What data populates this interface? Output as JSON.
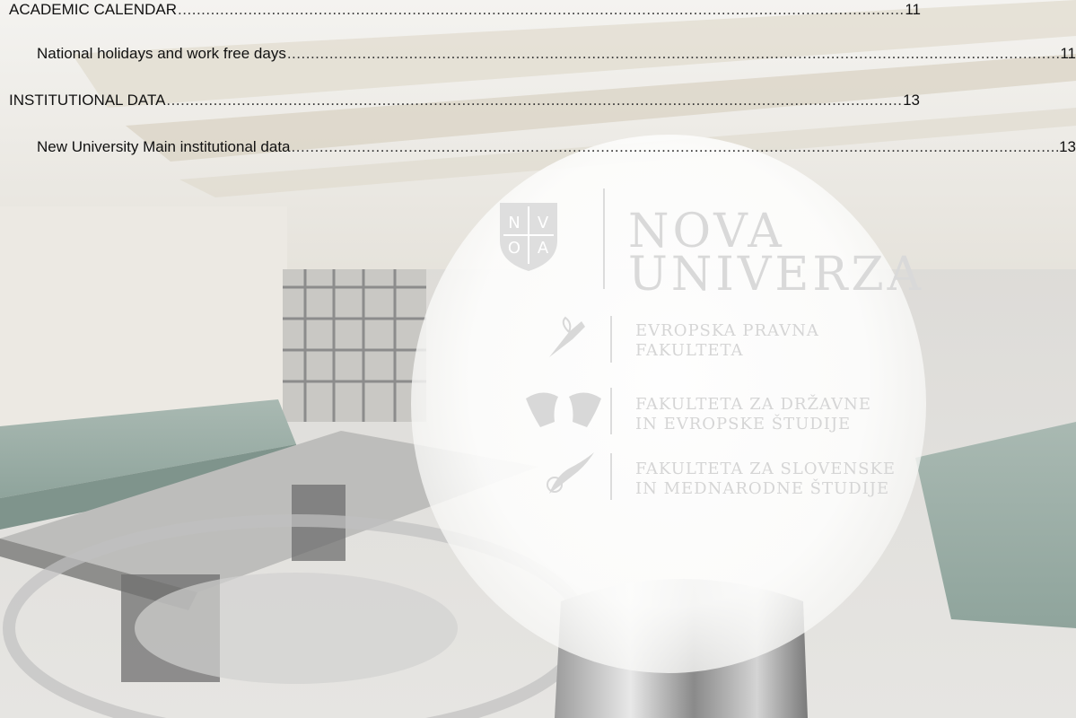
{
  "toc": [
    {
      "level": 1,
      "title": "ACADEMIC CALENDAR",
      "page": "11"
    },
    {
      "level": 2,
      "title": "National holidays and work free days",
      "page": "11"
    },
    {
      "level": 1,
      "title": "INSTITUTIONAL DATA",
      "page": "13"
    },
    {
      "level": 2,
      "title": "New University Main institutional data",
      "page": "13"
    }
  ],
  "logo": {
    "shield_letters": [
      "N",
      "V",
      "O",
      "A"
    ],
    "line1": "NOVA",
    "line2": "UNIVERZA"
  },
  "faculties": [
    {
      "line1": "EVROPSKA PRAVNA",
      "line2": "FAKULTETA",
      "icon": "bow-ribbon-icon"
    },
    {
      "line1": "FAKULTETA ZA DRŽAVNE",
      "line2": "IN EVROPSKE ŠTUDIJE",
      "icon": "twin-profiles-icon"
    },
    {
      "line1": "FAKULTETA ZA SLOVENSKE",
      "line2": "IN MEDNARODNE ŠTUDIJE",
      "icon": "quill-ribbon-icon"
    }
  ],
  "colors": {
    "text": "#111111",
    "logo_grey": "#d9d9d9",
    "bench_green": "#8fa49c"
  }
}
